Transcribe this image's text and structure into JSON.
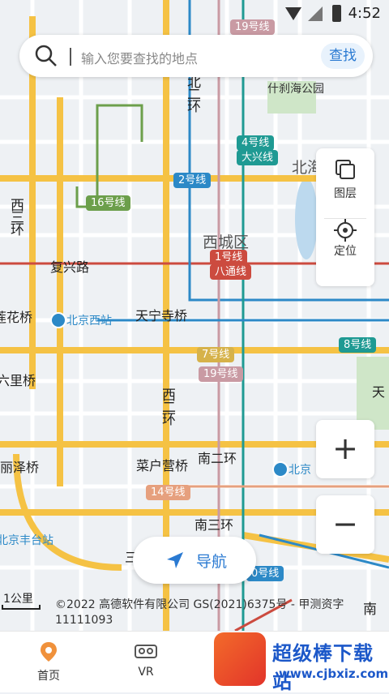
{
  "status_bar": {
    "time": "4:52"
  },
  "search": {
    "placeholder": "输入您要查找的地点",
    "button": "查找"
  },
  "map_controls": {
    "layers": "图层",
    "locate": "定位",
    "zoom_in": "+",
    "zoom_out": "−"
  },
  "navigate": {
    "label": "导航"
  },
  "map": {
    "districts": {
      "xicheng": "西城区"
    },
    "pois": {
      "shichahai": "什刹海公园",
      "beihai": "北海",
      "beijing_west": "北京西站",
      "beijing_south": "北京",
      "fengtai": "北京丰台站"
    },
    "roads": {
      "fuxing": "复兴路",
      "tianning": "天宁寺桥",
      "liuli": "六里桥",
      "lianhua": "莲花桥",
      "lize": "丽泽桥",
      "caihu": "菜户营桥",
      "nan2": "南二环",
      "nan3": "南三环",
      "xi2": "西二环",
      "xi3": "西三环",
      "bei2": "北二环",
      "nan": "南",
      "tian": "天",
      "san": "三"
    },
    "lines": {
      "l19a": "19号线",
      "l4": "4号线",
      "l4b": "大兴线",
      "l2": "2号线",
      "l16": "16号线",
      "l1": "1号线",
      "l1b": "八通线",
      "l7": "7号线",
      "l19b": "19号线",
      "l8": "8号线",
      "l14": "14号线",
      "l10": "0号线"
    },
    "scale": "1公里",
    "copyright": "©2022 高德软件有限公司 GS(2021)6375号 - 甲测资字11111093"
  },
  "tabs": [
    {
      "label": "首页"
    },
    {
      "label": "VR"
    }
  ],
  "watermark": {
    "title": "超级棒下载站",
    "url": "www.cjbxiz.com"
  },
  "colors": {
    "accent": "#2a7ad2",
    "ring_road": "#f5c244",
    "home_icon": "#f0913b"
  }
}
